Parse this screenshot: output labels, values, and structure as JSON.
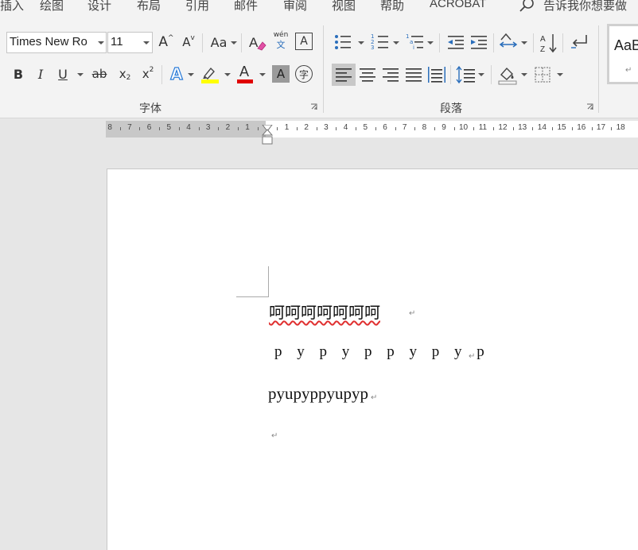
{
  "tabs": [
    "插入",
    "绘图",
    "设计",
    "布局",
    "引用",
    "邮件",
    "审阅",
    "视图",
    "帮助",
    "ACROBAT"
  ],
  "tell_me": "告诉我你想要做",
  "font": {
    "name": "Times New Ro",
    "size": "11",
    "grow_label": "A",
    "shrink_label": "A",
    "case_label": "Aa",
    "phonetic_top": "wén",
    "phonetic_bottom": "文",
    "border_label": "A",
    "bold": "B",
    "italic": "I",
    "underline": "U",
    "strike": "ab",
    "sub": "x",
    "sub_mark": "2",
    "sup": "x",
    "sup_mark": "2",
    "effects": "A",
    "font_color": "A",
    "shading": "A",
    "enclose": "字",
    "group_label": "字体",
    "highlight_color": "#ffff00",
    "font_color_value": "#e00000"
  },
  "paragraph": {
    "group_label": "段落"
  },
  "styles": {
    "preview": "AaB",
    "mark": "↵"
  },
  "ruler": {
    "left_numbers": [
      "8",
      "7",
      "6",
      "5",
      "4",
      "3",
      "2",
      "1"
    ],
    "right_numbers": [
      "1",
      "2",
      "3",
      "4",
      "5",
      "6",
      "7",
      "8",
      "9",
      "10",
      "11",
      "12",
      "13",
      "14",
      "15",
      "16",
      "17",
      "18"
    ]
  },
  "document": {
    "line1": "呵呵呵呵呵呵呵",
    "line2": "p y p y p p y p y p",
    "line3": "pyupyppyupyp",
    "paragraph_mark": "↵"
  }
}
